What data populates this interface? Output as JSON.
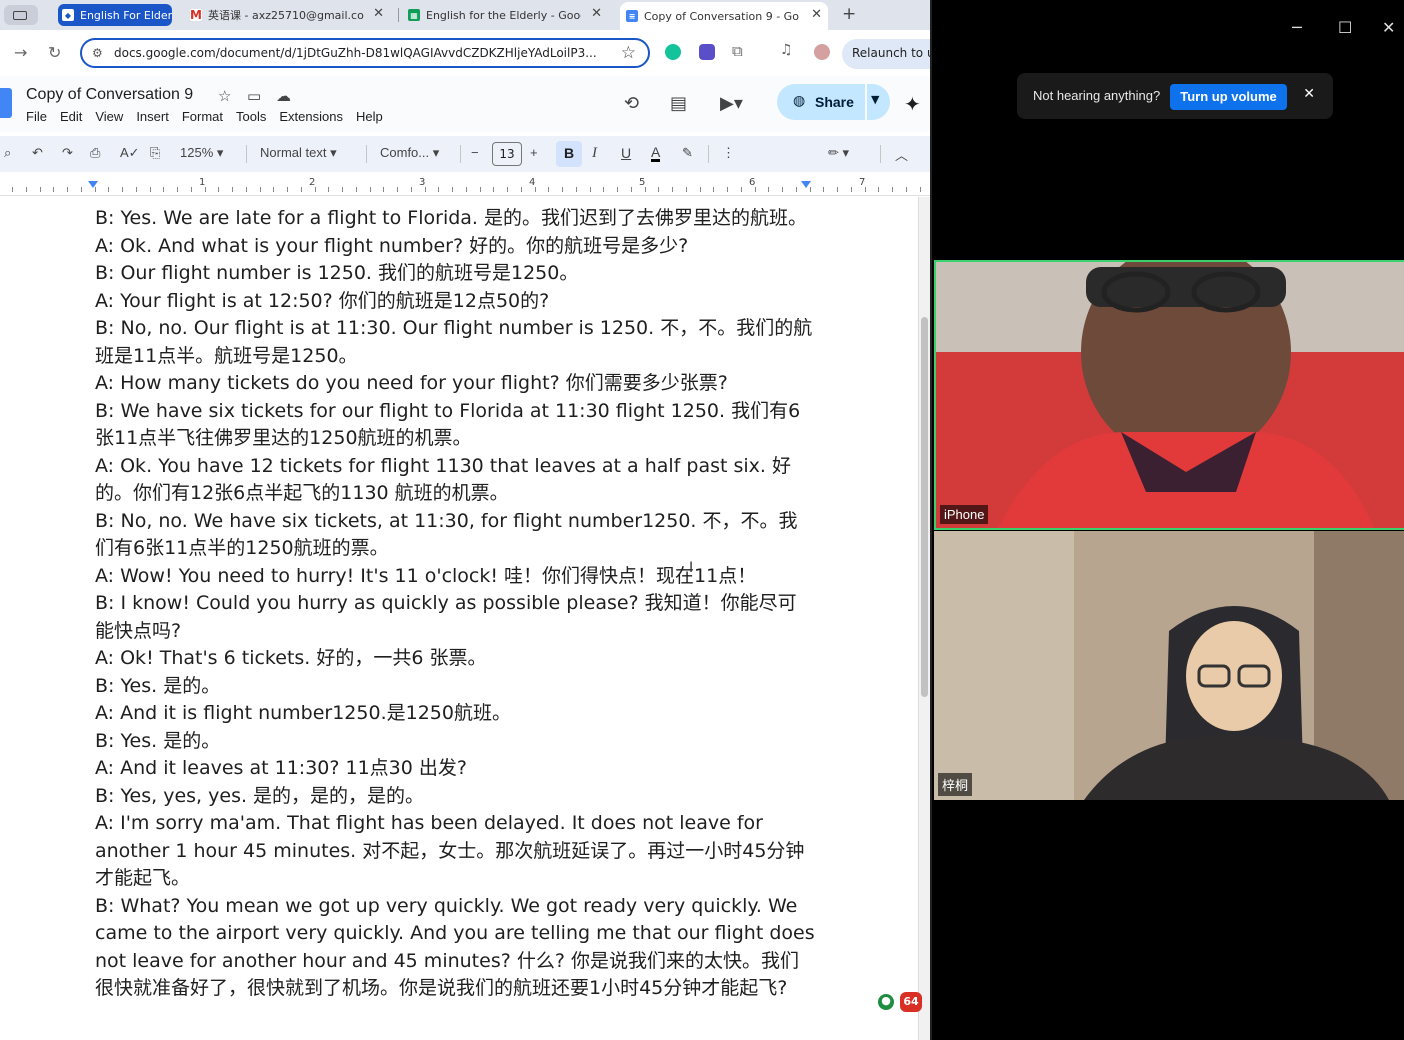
{
  "browser": {
    "tabs": [
      {
        "label": "English For Elderl",
        "favicon": "tab-zoom-icon"
      },
      {
        "label": "英语课 - axz25710@gmail.co",
        "favicon": "gmail-icon"
      },
      {
        "label": "English for the Elderly - Goog",
        "favicon": "sheets-icon"
      },
      {
        "label": "Copy of Conversation 9 - Goo",
        "favicon": "docs-icon"
      }
    ],
    "url": "docs.google.com/document/d/1jDtGuZhh-D81wlQAGIAvvdCZDKZHljeYAdLoilP3...",
    "relaunch_label": "Relaunch to u"
  },
  "docs": {
    "title": "Copy of Conversation 9",
    "menu": [
      "File",
      "Edit",
      "View",
      "Insert",
      "Format",
      "Tools",
      "Extensions",
      "Help"
    ],
    "share_label": "Share",
    "zoom": "125%",
    "style": "Normal text",
    "font": "Comfo...",
    "font_size": "13",
    "bold_label": "B",
    "italic_label": "I",
    "underline_label": "U",
    "text_color_label": "A",
    "ruler_numbers": [
      "1",
      "2",
      "3",
      "4",
      "5",
      "6",
      "7"
    ],
    "badge_count": "64",
    "paragraphs": [
      "B: Yes. We are late for a flight to Florida. 是的。我们迟到了去佛罗里达的航班。",
      "A: Ok. And what is your flight number? 好的。你的航班号是多少?",
      "B: Our flight number is 1250. 我们的航班号是1250。",
      "A: Your flight is at 12:50? 你们的航班是12点50的?",
      "B: No, no. Our flight is at 11:30. Our flight number is 1250. 不，不。我们的航班是11点半。航班号是1250。",
      "A: How many tickets do you need for your flight? 你们需要多少张票?",
      "B: We have six tickets for our flight to Florida at 11:30 flight 1250. 我们有6张11点半飞往佛罗里达的1250航班的机票。",
      "A: Ok. You have 12 tickets for flight 1130 that leaves at a half past six. 好的。你们有12张6点半起飞的1130 航班的机票。",
      "B: No, no. We have six tickets, at 11:30, for flight number1250. 不，不。我们有6张11点半的1250航班的票。",
      "A: Wow! You need to hurry! It's 11 o'clock! 哇！你们得快点！现在11点！",
      "B: I know! Could you hurry as quickly as possible please? 我知道！你能尽可能快点吗?",
      "A: Ok! That's 6 tickets. 好的，一共6 张票。",
      "B: Yes. 是的。",
      "A: And it is flight number1250.是1250航班。",
      "B: Yes. 是的。",
      "A: And it leaves at 11:30? 11点30 出发?",
      "B: Yes, yes, yes. 是的，是的，是的。",
      "A: I'm sorry ma'am. That flight has been delayed. It does not leave for another 1 hour 45 minutes. 对不起，女士。那次航班延误了。再过一小时45分钟才能起飞。",
      "B: What? You mean we got up very quickly. We got ready very quickly. We came to the airport very quickly. And you are telling me that our flight does not leave for another hour and 45 minutes? 什么? 你是说我们来的太快。我们很快就准备好了，很快就到了机场。你是说我们的航班还要1小时45分钟才能起飞?"
    ]
  },
  "meeting": {
    "banner_text": "Not hearing anything?",
    "banner_button": "Turn up volume",
    "participants": [
      {
        "name": "iPhone",
        "active_speaker": true
      },
      {
        "name": "梓桐",
        "active_speaker": false
      }
    ]
  },
  "colors": {
    "accent": "#1a56c8",
    "share_bg": "#c2e7ff",
    "speaker_border": "#3ad16c",
    "zoom_blue": "#0e72ed"
  }
}
